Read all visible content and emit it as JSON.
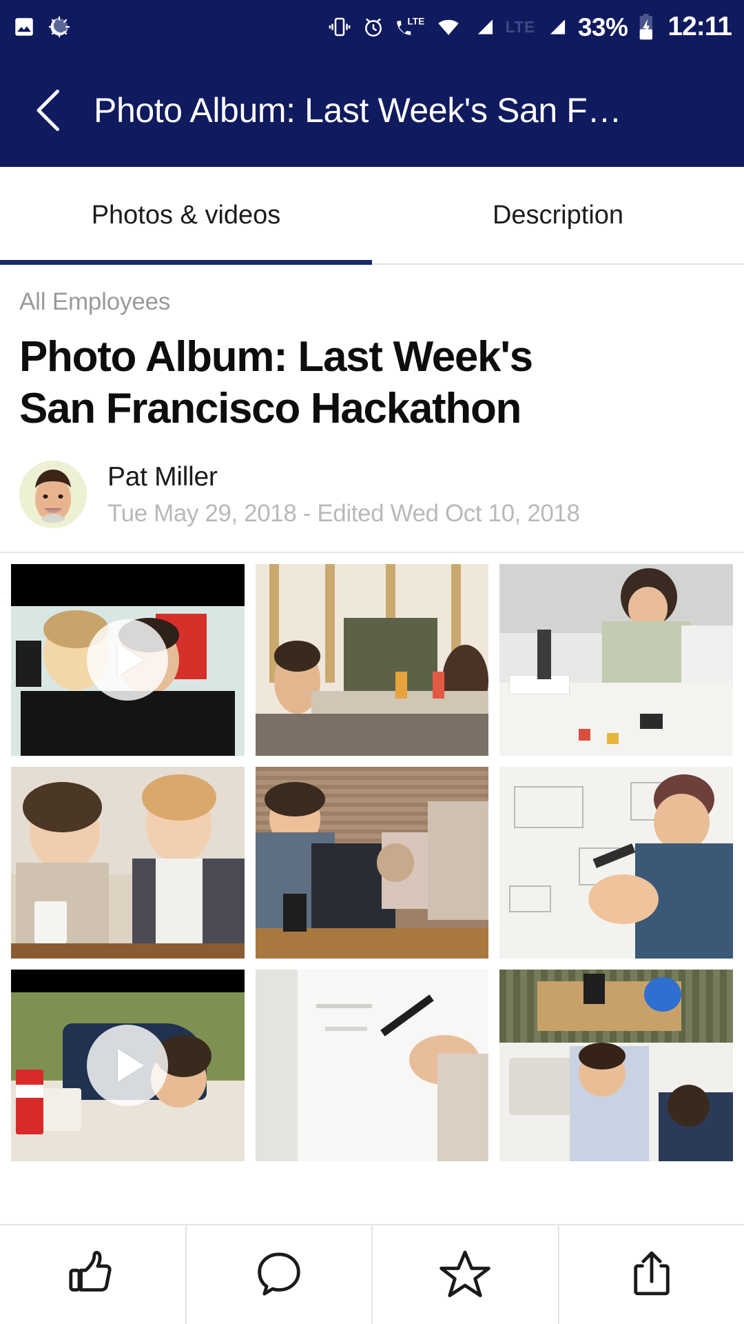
{
  "statusbar": {
    "icons_left": [
      "image-icon",
      "sync-spinner-icon"
    ],
    "icons_right": [
      "vibrate-icon",
      "alarm-icon",
      "call-lte-icon",
      "wifi-icon",
      "signal-1-icon",
      "lte-label",
      "signal-2-icon"
    ],
    "lte_label": "LTE",
    "battery_percent": "33%",
    "battery_icon": "battery-charging-icon",
    "time": "12:11"
  },
  "appbar": {
    "back_icon": "chevron-left-icon",
    "title": "Photo Album: Last Week's San F…"
  },
  "tabs": {
    "active_index": 0,
    "items": [
      {
        "label": "Photos & videos",
        "name": "tab-photos-videos"
      },
      {
        "label": "Description",
        "name": "tab-description"
      }
    ]
  },
  "article": {
    "eyebrow": "All Employees",
    "headline": "Photo Album: Last Week's San Francisco Hackathon",
    "author": "Pat Miller",
    "timestamp": "Tue May 29, 2018 - Edited Wed Oct 10, 2018"
  },
  "gallery": {
    "tiles": [
      {
        "name": "gallery-video-1",
        "type": "video",
        "has_play": true,
        "alt": "Two men in black t-shirts presenting at hackathon"
      },
      {
        "name": "gallery-photo-2",
        "type": "photo",
        "has_play": false,
        "alt": "People seated around a cafe table talking"
      },
      {
        "name": "gallery-photo-3",
        "type": "photo",
        "has_play": false,
        "alt": "Woman laughing at a workshop table with sticky notes"
      },
      {
        "name": "gallery-photo-4",
        "type": "photo",
        "has_play": false,
        "alt": "Two women with coffee cups in discussion"
      },
      {
        "name": "gallery-photo-5",
        "type": "photo",
        "has_play": false,
        "alt": "People relaxing on couch with pug and mugs"
      },
      {
        "name": "gallery-photo-6",
        "type": "photo",
        "has_play": false,
        "alt": "Man drawing a diagram on a whiteboard"
      },
      {
        "name": "gallery-video-7",
        "type": "video",
        "has_play": true,
        "alt": "Man resting on a couch beside a Coca-Cola cup"
      },
      {
        "name": "gallery-photo-8",
        "type": "photo",
        "has_play": false,
        "alt": "Hand writing on a whiteboard with a marker"
      },
      {
        "name": "gallery-photo-9",
        "type": "photo",
        "has_play": false,
        "alt": "Overhead view of people working at a desk"
      }
    ]
  },
  "actionbar": {
    "actions": [
      {
        "label": "Like",
        "icon": "thumbs-up-icon",
        "name": "like-button"
      },
      {
        "label": "Comment",
        "icon": "comment-icon",
        "name": "comment-button"
      },
      {
        "label": "Favorite",
        "icon": "star-icon",
        "name": "favorite-button"
      },
      {
        "label": "Share",
        "icon": "share-upload-icon",
        "name": "share-button"
      }
    ]
  },
  "colors": {
    "brand_navy": "#101a5e",
    "tab_indicator": "#1b2a6b",
    "muted_text": "#9a9a9a",
    "timestamp_text": "#b9b9b9"
  }
}
